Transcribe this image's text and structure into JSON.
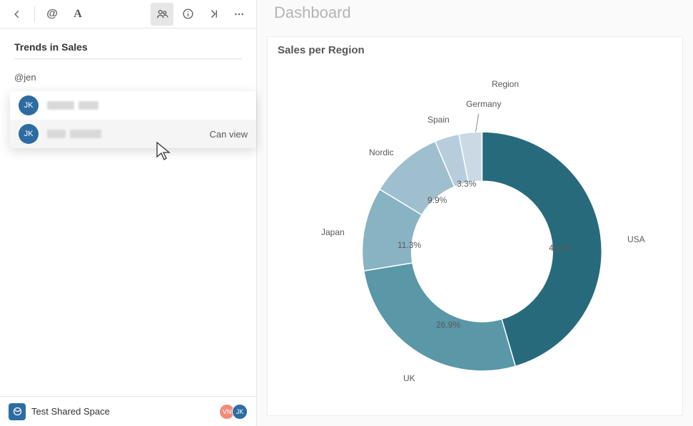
{
  "header": {
    "title": "Dashboard"
  },
  "toolbar": {
    "back_name": "back-button",
    "at_name": "mention-button",
    "text_name": "text-format-button",
    "people_name": "share-people-button",
    "info_name": "info-button",
    "last_name": "go-to-end-button",
    "more_name": "more-options-button"
  },
  "sidebar": {
    "note_title": "Trends in Sales",
    "mention_input": "@jen",
    "dropdown": {
      "items": [
        {
          "initials": "JK",
          "permission": ""
        },
        {
          "initials": "JK",
          "permission": "Can view"
        }
      ]
    }
  },
  "footer": {
    "space_name": "Test Shared Space",
    "avatars": [
      {
        "initials": "VN",
        "color": "#f08b7a"
      },
      {
        "initials": "JK",
        "color": "#2d6ca2"
      }
    ]
  },
  "chart": {
    "title": "Sales per Region",
    "legend_title": "Region"
  },
  "chart_data": {
    "type": "pie",
    "title": "Sales per Region",
    "series_name": "Region",
    "categories": [
      "USA",
      "UK",
      "Japan",
      "Nordic",
      "Spain",
      "Germany"
    ],
    "values": [
      45.5,
      26.9,
      11.3,
      9.9,
      3.3,
      3.1
    ],
    "colors": {
      "USA": "#276a7c",
      "UK": "#5a97a7",
      "Japan": "#87b3c2",
      "Nordic": "#9fbfcf",
      "Spain": "#b8cddb",
      "Germany": "#cad9e3"
    },
    "labels": {
      "USA": "45.5%",
      "UK": "26.9%",
      "Japan": "11.3%",
      "Nordic": "9.9%",
      "Spain": "3.3%"
    },
    "donut": true
  }
}
